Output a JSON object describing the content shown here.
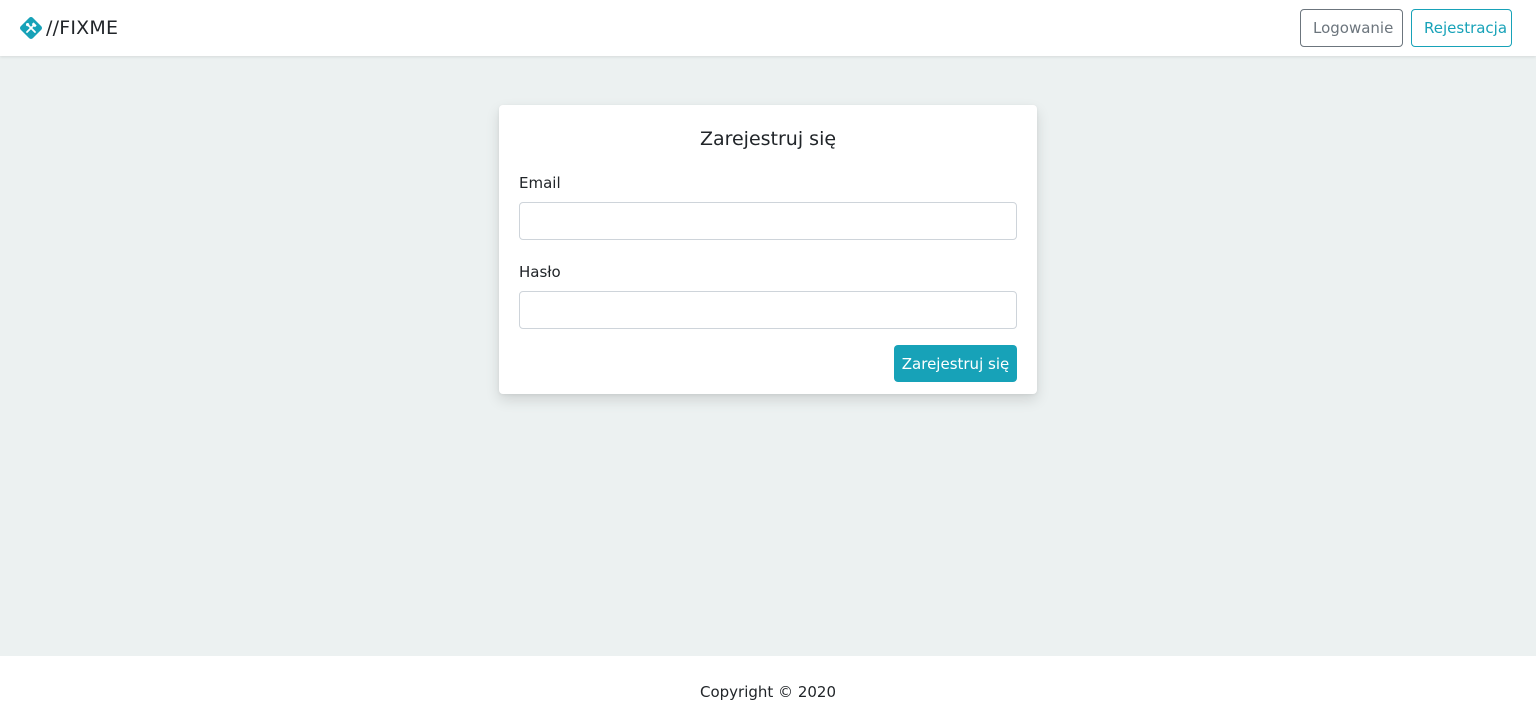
{
  "brand": {
    "title": "//FIXME",
    "logo_icon": "tools-icon",
    "accent_color": "#17a2b8"
  },
  "nav": {
    "login_label": "Logowanie",
    "register_label": "Rejestracja"
  },
  "register_form": {
    "title": "Zarejestruj się",
    "email_label": "Email",
    "email_value": "",
    "password_label": "Hasło",
    "password_value": "",
    "submit_label": "Zarejestruj się"
  },
  "footer": {
    "copyright": "Copyright © 2020"
  }
}
